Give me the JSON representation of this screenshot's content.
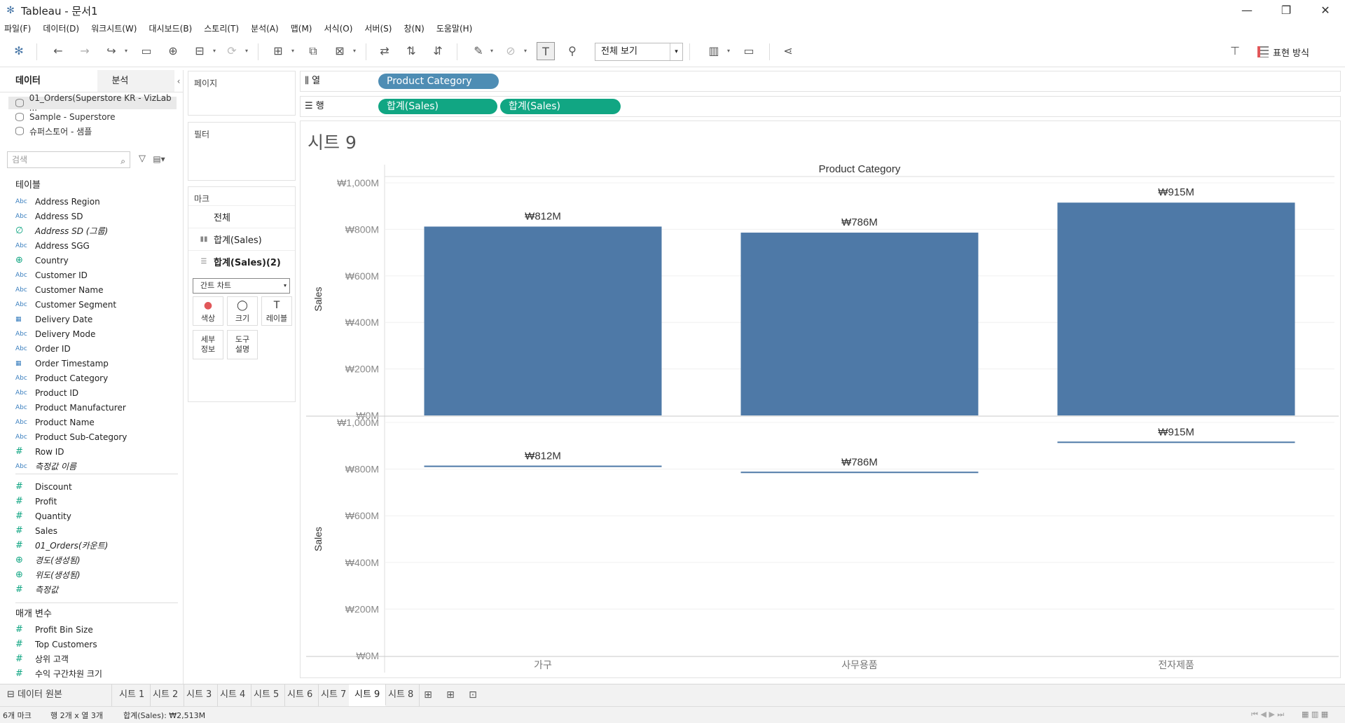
{
  "window": {
    "title": "Tableau - 문서1",
    "minimize": "—",
    "restore": "❐",
    "close": "✕"
  },
  "menu": [
    "파일(F)",
    "데이터(D)",
    "워크시트(W)",
    "대시보드(B)",
    "스토리(T)",
    "분석(A)",
    "맵(M)",
    "서식(O)",
    "서버(S)",
    "창(N)",
    "도움말(H)"
  ],
  "toolbar": {
    "fit_select": "전체 보기",
    "show_me": "표현 방식"
  },
  "datapane": {
    "tab_data": "데이터",
    "tab_analysis": "분석",
    "datasources": [
      "01_Orders(Superstore KR - VizLab ...",
      "Sample - Superstore",
      "슈퍼스토어 - 샘플"
    ],
    "search_placeholder": "검색",
    "tables_header": "테이블",
    "dimensions": [
      {
        "type": "Abc",
        "name": "Address Region"
      },
      {
        "type": "Abc",
        "name": "Address SD"
      },
      {
        "type": "∅",
        "name": "Address SD (그룹)"
      },
      {
        "type": "Abc",
        "name": "Address SGG"
      },
      {
        "type": "⊕",
        "name": "Country"
      },
      {
        "type": "Abc",
        "name": "Customer ID"
      },
      {
        "type": "Abc",
        "name": "Customer Name"
      },
      {
        "type": "Abc",
        "name": "Customer Segment"
      },
      {
        "type": "▦",
        "name": "Delivery Date"
      },
      {
        "type": "Abc",
        "name": "Delivery Mode"
      },
      {
        "type": "Abc",
        "name": "Order ID"
      },
      {
        "type": "▦",
        "name": "Order Timestamp"
      },
      {
        "type": "Abc",
        "name": "Product Category"
      },
      {
        "type": "Abc",
        "name": "Product ID"
      },
      {
        "type": "Abc",
        "name": "Product Manufacturer"
      },
      {
        "type": "Abc",
        "name": "Product Name"
      },
      {
        "type": "Abc",
        "name": "Product Sub-Category"
      },
      {
        "type": "#",
        "name": "Row ID"
      },
      {
        "type": "Abc",
        "name": "측정값 이름"
      }
    ],
    "measures": [
      {
        "type": "#",
        "name": "Discount"
      },
      {
        "type": "#",
        "name": "Profit"
      },
      {
        "type": "#",
        "name": "Quantity"
      },
      {
        "type": "#",
        "name": "Sales"
      },
      {
        "type": "#",
        "name": "01_Orders(카운트)"
      },
      {
        "type": "⊕",
        "name": "경도(생성됨)"
      },
      {
        "type": "⊕",
        "name": "위도(생성됨)"
      },
      {
        "type": "#",
        "name": "측정값"
      }
    ],
    "params_header": "매개 변수",
    "parameters": [
      {
        "type": "#",
        "name": "Profit Bin Size"
      },
      {
        "type": "#",
        "name": "Top Customers"
      },
      {
        "type": "#",
        "name": "상위 고객"
      },
      {
        "type": "#",
        "name": "수익 구간차원 크기"
      }
    ]
  },
  "pages_label": "페이지",
  "filters_label": "필터",
  "marks": {
    "label": "마크",
    "rows": [
      "전체",
      "합계(Sales)",
      "합계(Sales)(2)"
    ],
    "type": "간트 차트",
    "buttons": [
      {
        "label": "색상",
        "icon": "●"
      },
      {
        "label": "크기",
        "icon": "◯"
      },
      {
        "label": "레이블",
        "icon": "T"
      },
      {
        "label": "세부\n정보",
        "icon": ""
      },
      {
        "label": "도구\n설명",
        "icon": ""
      }
    ]
  },
  "shelves": {
    "columns_label": "열",
    "rows_label": "행",
    "columns_pills": [
      "Product Category"
    ],
    "rows_pills": [
      "합계(Sales)",
      "합계(Sales)"
    ]
  },
  "sheet": {
    "title": "시트 9"
  },
  "chart_data": {
    "type": "bar",
    "header": "Product Category",
    "categories": [
      "가구",
      "사무용품",
      "전자제품"
    ],
    "ylabel": "Sales",
    "ylim": [
      0,
      1000
    ],
    "yticks": [
      "₩0M",
      "₩200M",
      "₩400M",
      "₩600M",
      "₩800M",
      "₩1,000M"
    ],
    "top_panel": {
      "mark": "bar",
      "values": [
        812,
        786,
        915
      ],
      "labels": [
        "₩812M",
        "₩786M",
        "₩915M"
      ]
    },
    "bottom_panel": {
      "mark": "gantt",
      "values": [
        812,
        786,
        915
      ],
      "labels": [
        "₩812M",
        "₩786M",
        "₩915M"
      ]
    },
    "color": "#4e79a7"
  },
  "bottom_tabs": {
    "datasource": "데이터 원본",
    "sheets": [
      "시트 1",
      "시트 2",
      "시트 3",
      "시트 4",
      "시트 5",
      "시트 6",
      "시트 7",
      "시트 9",
      "시트 8"
    ],
    "active": "시트 9"
  },
  "status": {
    "marks": "6개 마크",
    "dims": "행 2개 x 열 3개",
    "sum": "합계(Sales): ₩2,513M"
  }
}
